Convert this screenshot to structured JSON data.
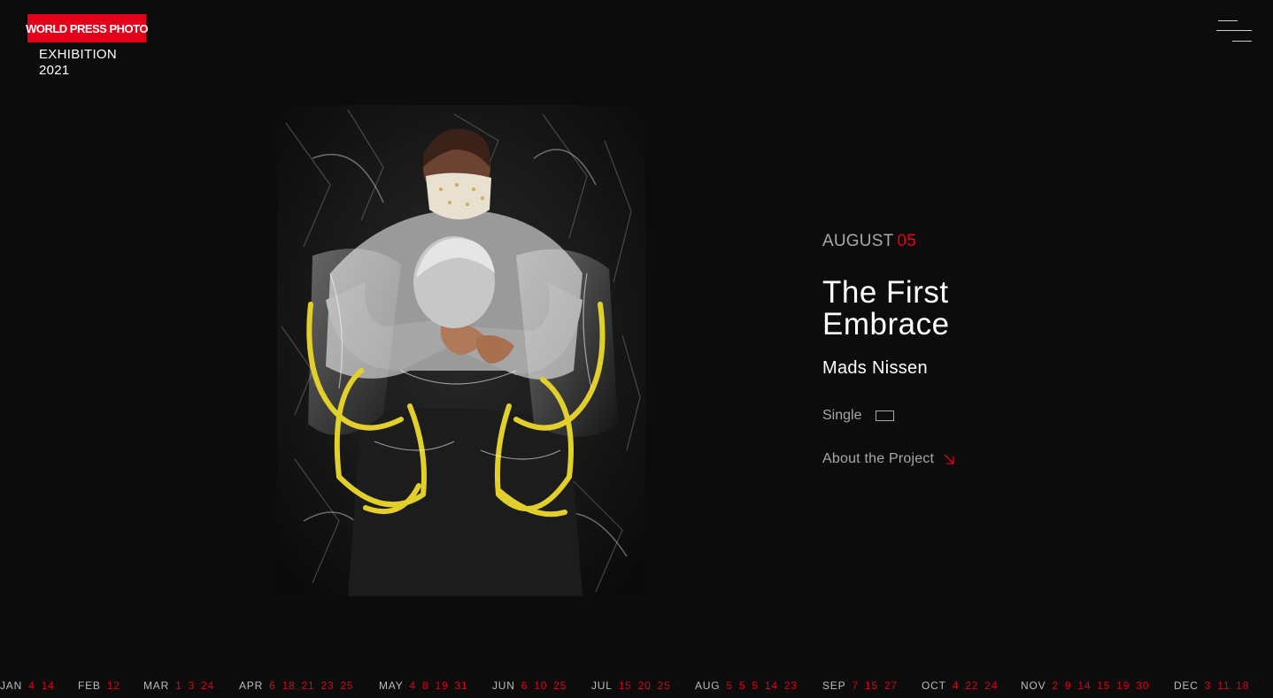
{
  "header": {
    "logo_text": "WORLD PRESS PHOTO",
    "exhibition_line1": "EXHIBITION",
    "exhibition_line2": "2021",
    "menu_icon": "hamburger-icon"
  },
  "colors": {
    "accent": "#e2001a",
    "background": "#0c0c0c",
    "muted_text": "#a8a8a8"
  },
  "photo": {
    "alt": "The First Embrace"
  },
  "info": {
    "month": "AUGUST",
    "day": "05",
    "title_line1": "The First",
    "title_line2": "Embrace",
    "author": "Mads Nissen",
    "category": "Single",
    "category_icon": "single-frame-icon",
    "about_label": "About the Project",
    "about_icon": "arrow-down-right-icon"
  },
  "timeline": [
    {
      "month": "JAN",
      "days": [
        "4",
        "14"
      ]
    },
    {
      "month": "FEB",
      "days": [
        "12"
      ]
    },
    {
      "month": "MAR",
      "days": [
        "1",
        "3",
        "24"
      ]
    },
    {
      "month": "APR",
      "days": [
        "6",
        "18",
        "21",
        "23",
        "25"
      ]
    },
    {
      "month": "MAY",
      "days": [
        "4",
        "8",
        "19",
        "31"
      ]
    },
    {
      "month": "JUN",
      "days": [
        "6",
        "10",
        "25"
      ]
    },
    {
      "month": "JUL",
      "days": [
        "15",
        "20",
        "25"
      ]
    },
    {
      "month": "AUG",
      "days": [
        "5",
        "5",
        "5",
        "14",
        "23"
      ]
    },
    {
      "month": "SEP",
      "days": [
        "7",
        "15",
        "27"
      ]
    },
    {
      "month": "OCT",
      "days": [
        "4",
        "22",
        "24"
      ]
    },
    {
      "month": "NOV",
      "days": [
        "2",
        "9",
        "14",
        "15",
        "19",
        "30"
      ]
    },
    {
      "month": "DEC",
      "days": [
        "3",
        "11",
        "18"
      ]
    }
  ]
}
